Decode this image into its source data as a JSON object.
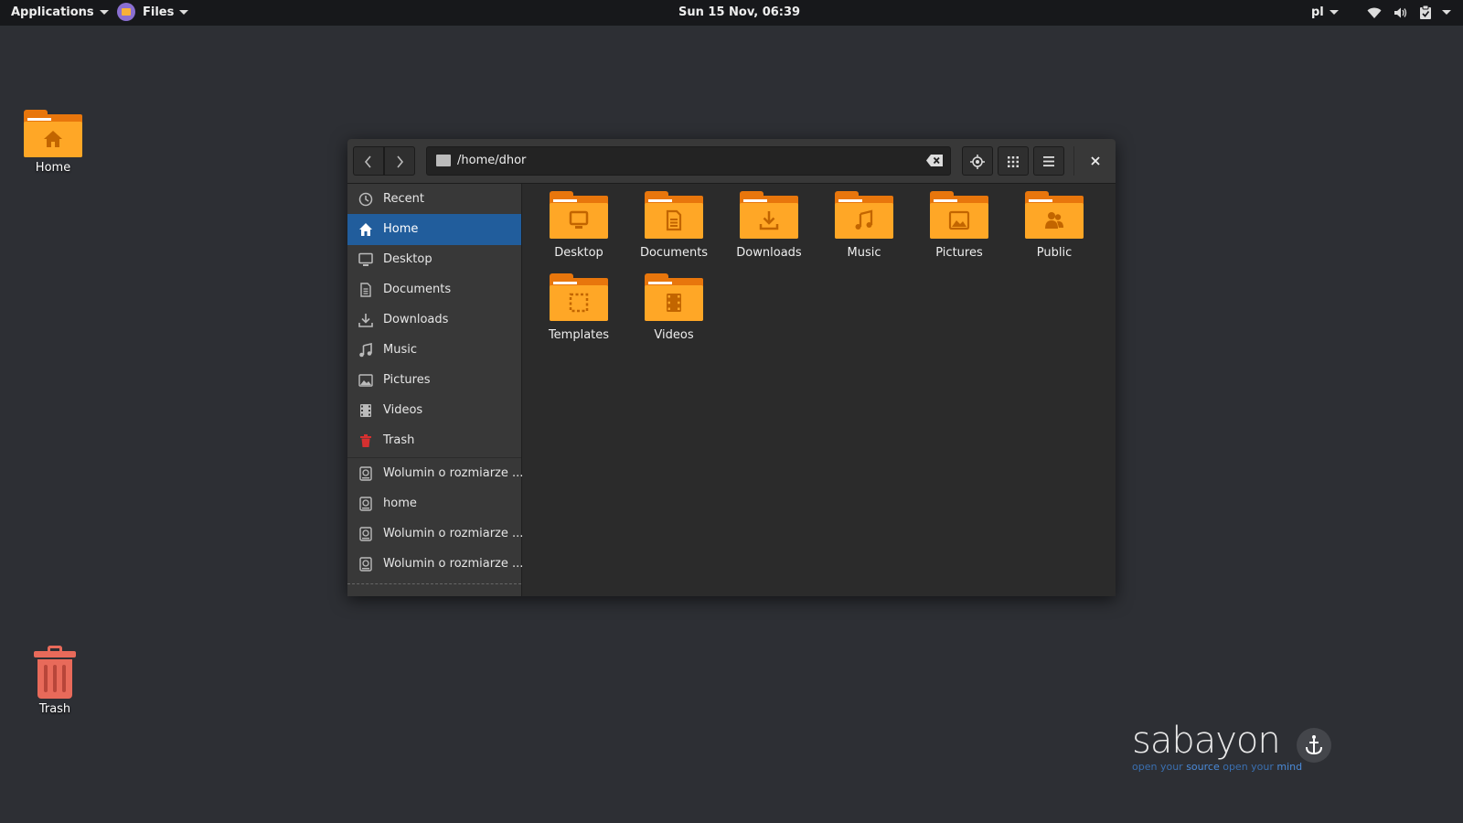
{
  "topbar": {
    "applications": "Applications",
    "files": "Files",
    "clock": "Sun 15 Nov, 06:39",
    "keyboard_layout": "pl",
    "icons": [
      "wifi-icon",
      "volume-icon",
      "clipboard-check-icon"
    ]
  },
  "desktop": {
    "home_label": "Home",
    "trash_label": "Trash"
  },
  "window": {
    "path": "/home/dhor",
    "sidebar": [
      {
        "label": "Recent",
        "icon": "clock-icon"
      },
      {
        "label": "Home",
        "icon": "home-icon",
        "active": true
      },
      {
        "label": "Desktop",
        "icon": "desktop-icon"
      },
      {
        "label": "Documents",
        "icon": "document-icon"
      },
      {
        "label": "Downloads",
        "icon": "download-icon"
      },
      {
        "label": "Music",
        "icon": "music-icon"
      },
      {
        "label": "Pictures",
        "icon": "picture-icon"
      },
      {
        "label": "Videos",
        "icon": "film-icon"
      },
      {
        "label": "Trash",
        "icon": "trash-icon"
      },
      {
        "label": "Wolumin o rozmiarze ...",
        "icon": "drive-icon"
      },
      {
        "label": "home",
        "icon": "drive-icon"
      },
      {
        "label": "Wolumin o rozmiarze ...",
        "icon": "drive-icon"
      },
      {
        "label": "Wolumin o rozmiarze ...",
        "icon": "drive-icon"
      }
    ],
    "folders": [
      {
        "label": "Desktop",
        "icon": "desktop-icon"
      },
      {
        "label": "Documents",
        "icon": "document-icon"
      },
      {
        "label": "Downloads",
        "icon": "download-icon"
      },
      {
        "label": "Music",
        "icon": "music-icon"
      },
      {
        "label": "Pictures",
        "icon": "picture-icon"
      },
      {
        "label": "Public",
        "icon": "people-icon"
      },
      {
        "label": "Templates",
        "icon": "template-icon"
      },
      {
        "label": "Videos",
        "icon": "film-icon"
      }
    ]
  },
  "logo": {
    "name": "sabayon",
    "tag_1": "open your ",
    "tag_2": "source",
    "tag_3": " open your ",
    "tag_4": "mind"
  },
  "colors": {
    "folder_front": "#ffa726",
    "folder_back": "#e8760c",
    "selection": "#215d9c",
    "desktop_bg": "#2d2f34"
  }
}
